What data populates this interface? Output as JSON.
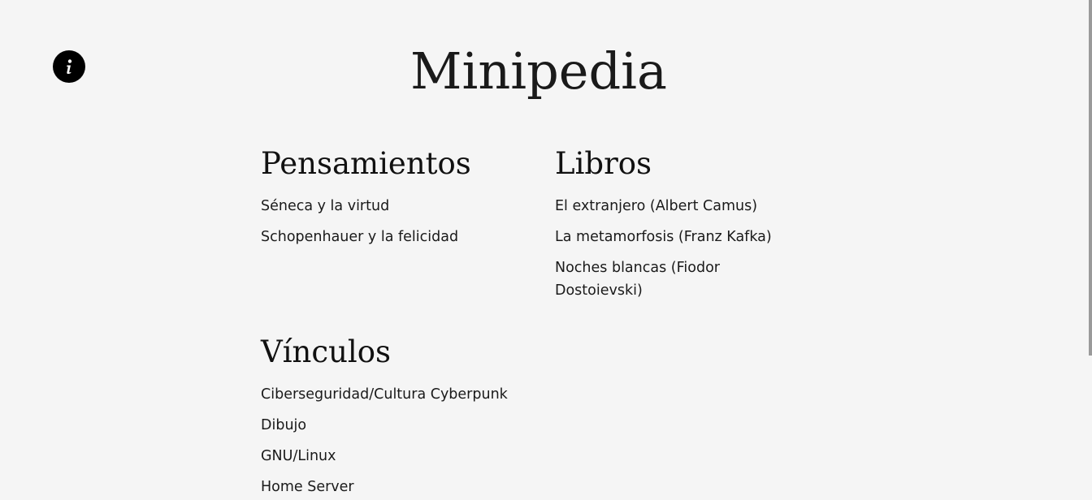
{
  "site": {
    "title": "Minipedia",
    "info_icon": "info-icon"
  },
  "sections": {
    "thoughts": {
      "heading": "Pensamientos",
      "items": [
        "Séneca y la virtud",
        "Schopenhauer y la felicidad"
      ]
    },
    "books": {
      "heading": "Libros",
      "items": [
        "El extranjero (Albert Camus)",
        "La metamorfosis (Franz Kafka)",
        "Noches blancas (Fiodor Dostoievski)"
      ]
    },
    "links": {
      "heading": "Vínculos",
      "items": [
        "Ciberseguridad/Cultura Cyberpunk",
        "Dibujo",
        "GNU/Linux",
        "Home Server"
      ]
    }
  }
}
